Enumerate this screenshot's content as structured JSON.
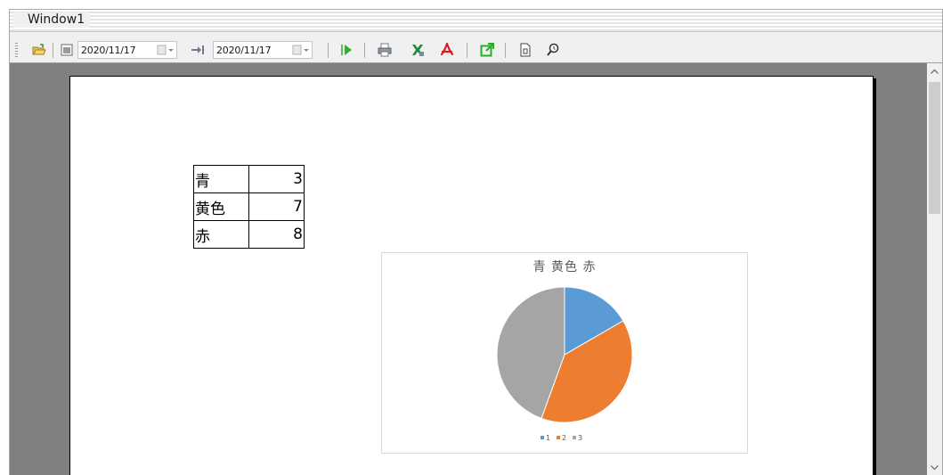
{
  "window": {
    "title": "Window1"
  },
  "toolbar": {
    "start_date": "2020/11/17",
    "end_date": "2020/11/17",
    "icons": [
      "open-folder-icon",
      "calendar-icon",
      "dropdown-icon",
      "arrow-right-icon",
      "calendar-icon",
      "dropdown-icon",
      "run-icon",
      "print-icon",
      "excel-export-icon",
      "pdf-export-icon",
      "external-open-icon",
      "page-setup-icon",
      "zoom-icon"
    ]
  },
  "table": {
    "rows": [
      {
        "label": "青",
        "value": "3"
      },
      {
        "label": "黄色",
        "value": "7"
      },
      {
        "label": "赤",
        "value": "8"
      }
    ]
  },
  "chart_data": {
    "type": "pie",
    "title": "青 黄色 赤",
    "labels": [
      "1",
      "2",
      "3"
    ],
    "values": [
      3,
      7,
      8
    ],
    "colors": [
      "#5b9bd5",
      "#ed7d31",
      "#a5a5a5"
    ],
    "legend": "bottom"
  }
}
